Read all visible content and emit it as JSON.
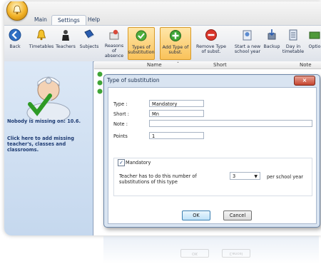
{
  "tabs": [
    {
      "label": "Main"
    },
    {
      "label": "Settings"
    },
    {
      "label": "Help"
    }
  ],
  "ribbon": {
    "buttons": [
      {
        "label": "Back",
        "icon": "back-arrow-icon"
      },
      {
        "label": "Timetables",
        "icon": "bell-icon"
      },
      {
        "label": "Teachers",
        "icon": "teacher-icon"
      },
      {
        "label": "Subjects",
        "icon": "book-icon"
      },
      {
        "label": "Reasons of absence",
        "icon": "absence-icon"
      },
      {
        "label": "Types of substitution",
        "icon": "substitution-types-icon"
      },
      {
        "label": "Add Type of subst.",
        "icon": "add-icon"
      },
      {
        "label": "Remove Type of subst.",
        "icon": "remove-icon"
      },
      {
        "label": "Start a new school year",
        "icon": "new-year-icon"
      },
      {
        "label": "Backup",
        "icon": "backup-icon"
      },
      {
        "label": "Day in timetable",
        "icon": "day-timetable-icon"
      },
      {
        "label": "Optio",
        "icon": "options-icon"
      }
    ]
  },
  "sidebar": {
    "missing_text": "Nobody is missing on: 10.6.",
    "add_missing_link": "Click here to add missing teacher's, classes and classrooms."
  },
  "list": {
    "columns": [
      "Name",
      "Short",
      "Note"
    ]
  },
  "dialog": {
    "title": "Type of substitution",
    "type_label": "Type :",
    "type_value": "Mandatory",
    "short_label": "Short :",
    "short_value": "Mn",
    "note_label": "Note :",
    "note_value": "",
    "points_label": "Points",
    "points_value": "1",
    "mandatory_label": "Mandatory",
    "mandatory_checked": true,
    "teacher_text": "Teacher has to do this number of substitutions of this type",
    "count_value": "3",
    "per_year_text": "per school year",
    "ok_label": "OK",
    "cancel_label": "Cancel"
  },
  "colors": {
    "accent": "#f9c25a",
    "sidebar": "#c5d8ee",
    "close_button": "#c4442f"
  }
}
